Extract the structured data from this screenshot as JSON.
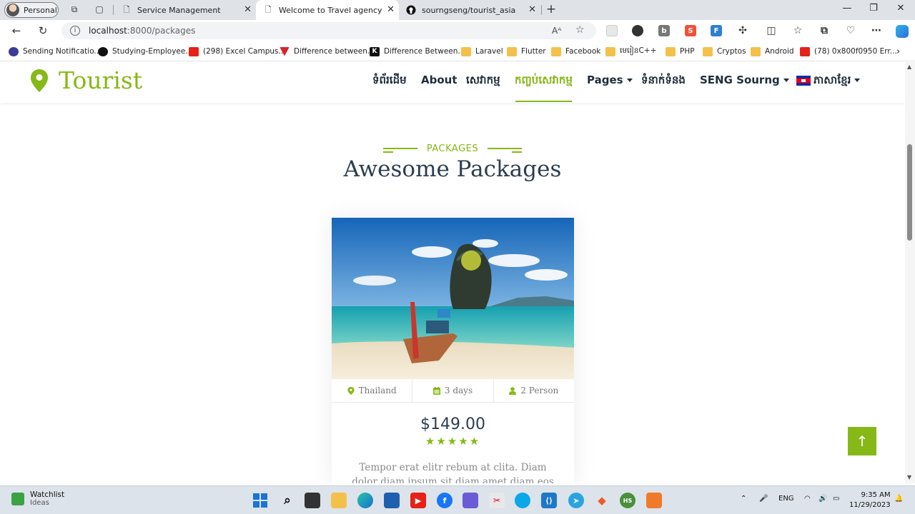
{
  "browser": {
    "profile_label": "Personal",
    "tabs": [
      {
        "title": "Service Management",
        "active": false
      },
      {
        "title": "Welcome to Travel agency",
        "active": true
      },
      {
        "title": "sourngseng/tourist_asia",
        "active": false
      }
    ],
    "url_host": "localhost",
    "url_rest": ":8000/packages",
    "bookmarks": [
      {
        "label": "Sending Notificatio...",
        "icon": "notification-icon"
      },
      {
        "label": "Studying-Employee...",
        "icon": "github-icon"
      },
      {
        "label": "(298) Excel Campus...",
        "icon": "youtube-icon"
      },
      {
        "label": "Difference between...",
        "icon": "vivaldi-icon"
      },
      {
        "label": "Difference Between...",
        "icon": "k-icon"
      },
      {
        "label": "Laravel",
        "icon": "folder-icon"
      },
      {
        "label": "Flutter",
        "icon": "folder-icon"
      },
      {
        "label": "Facebook",
        "icon": "folder-icon"
      },
      {
        "label": "មេរៀនC++",
        "icon": "folder-icon"
      },
      {
        "label": "PHP",
        "icon": "folder-icon"
      },
      {
        "label": "Cryptos",
        "icon": "folder-icon"
      },
      {
        "label": "Android",
        "icon": "folder-icon"
      },
      {
        "label": "(78) 0x800f0950 Err...",
        "icon": "youtube-icon"
      }
    ]
  },
  "site": {
    "brand": "Tourist",
    "menu": {
      "home": "ទំព័រដើម",
      "about": "About",
      "services": "សេវាកម្ម",
      "packages": "កញ្ចប់សេវាកម្ម",
      "pages": "Pages",
      "contact": "ទំនាក់ទំនង",
      "user": "SENG Sourng",
      "language": "ភាសាខ្មែរ"
    },
    "section": {
      "kicker": "PACKAGES",
      "title": "Awesome Packages"
    },
    "package": {
      "location": "Thailand",
      "duration": "3 days",
      "persons": "2 Person",
      "price": "$149.00",
      "rating": 5,
      "stars": "★★★★★",
      "description": "Tempor erat elitr rebum at clita. Diam dolor diam ipsum sit diam amet diam eos"
    },
    "back_to_top": "↑"
  },
  "taskbar": {
    "widget_title": "Watchlist",
    "widget_sub": "Ideas",
    "language": "ENG",
    "time": "9:35 AM",
    "date": "11/29/2023"
  },
  "colors": {
    "accent": "#86b817",
    "heading": "#2c3e50"
  }
}
